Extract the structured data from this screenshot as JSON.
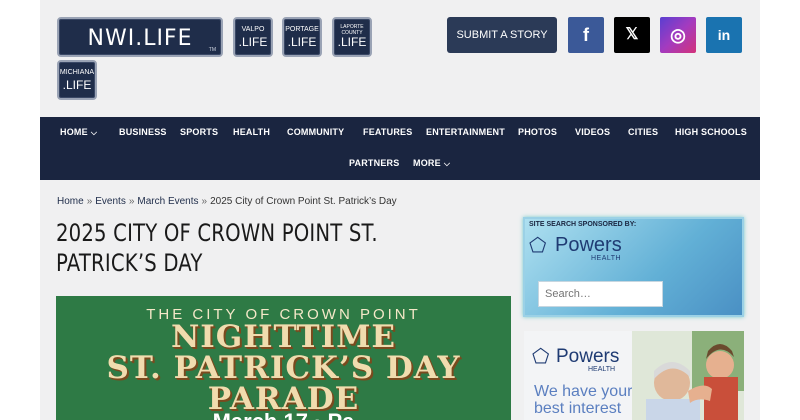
{
  "header": {
    "main_plate": {
      "text": "NWI.LIFE",
      "tm": "TM"
    },
    "plates": [
      {
        "top": "VALPO",
        "bottom": ".LIFE"
      },
      {
        "top": "PORTAGE",
        "bottom": ".LIFE"
      },
      {
        "top": "LAPORTE COUNTY",
        "bottom": ".LIFE"
      },
      {
        "top": "MICHIANA",
        "bottom": ".LIFE"
      }
    ],
    "submit_label": "SUBMIT A STORY",
    "social": {
      "facebook": "f",
      "x": "𝕏",
      "instagram": "◎",
      "linkedin": "in"
    }
  },
  "nav": {
    "items": [
      "HOME",
      "BUSINESS",
      "SPORTS",
      "HEALTH",
      "COMMUNITY",
      "FEATURES",
      "ENTERTAINMENT",
      "PHOTOS",
      "VIDEOS",
      "CITIES",
      "HIGH SCHOOLS",
      "PARTNERS",
      "MORE"
    ],
    "chevron": "⌵"
  },
  "breadcrumb": {
    "home": "Home",
    "events": "Events",
    "march": "March Events",
    "current": "2025 City of Crown Point St. Patrick’s Day",
    "sep": "»"
  },
  "article": {
    "title": "2025 CITY OF CROWN POINT ST. PATRICK’S DAY",
    "poster": {
      "line1": "THE CITY OF CROWN POINT",
      "line2a": "NIGHTTIME",
      "line2b": "ST. PATRICK’S DAY",
      "line2c": "PARADE",
      "line3": "March 17 · Pa"
    }
  },
  "sidebar": {
    "sponsor_label": "SITE SEARCH SPONSORED BY:",
    "brand": "Powers",
    "brand_sub": "HEALTH",
    "search_placeholder": "Search…",
    "ad": {
      "brand": "Powers",
      "brand_sub": "HEALTH",
      "tagline": "We have your best interest"
    }
  },
  "colors": {
    "nav_bg": "#1a2540",
    "accent": "#2b3a57",
    "poster_green": "#2e7a45"
  }
}
